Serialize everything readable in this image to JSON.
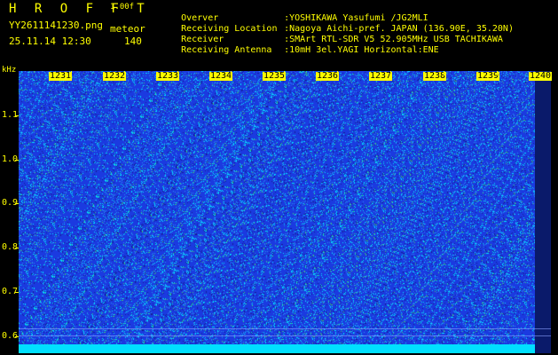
{
  "header": {
    "app_title": "H R O F F T",
    "version": "1.00f",
    "file_name": "YY2611141230.png",
    "datetime": "25.11.14 12:30",
    "meteor_label": "meteor",
    "meteor_count": "140",
    "meta": [
      {
        "key": "Overver",
        "value": ":YOSHIKAWA Yasufumi /JG2MLI"
      },
      {
        "key": "Receiving Location",
        "value": ":Nagoya Aichi-pref. JAPAN (136.90E, 35.20N)"
      },
      {
        "key": "Receiver",
        "value": ":SMArt RTL-SDR V5 52.905MHz USB TACHIKAWA"
      },
      {
        "key": "Receiving Antenna",
        "value": ":10mH 3el.YAGI Horizontal:ENE"
      }
    ]
  },
  "spectrogram": {
    "y_unit": "kHz",
    "y_ticks": [
      "1.1",
      "1.0",
      "0.9",
      "0.8",
      "0.7",
      "0.6"
    ],
    "x_labels": [
      "1231",
      "1232",
      "1233",
      "1234",
      "1235",
      "1236",
      "1237",
      "1238",
      "1239",
      "1240"
    ],
    "colors": {
      "background": "#1b3ae0",
      "noise": "#00e0ff",
      "axis": "#ffff00"
    }
  }
}
